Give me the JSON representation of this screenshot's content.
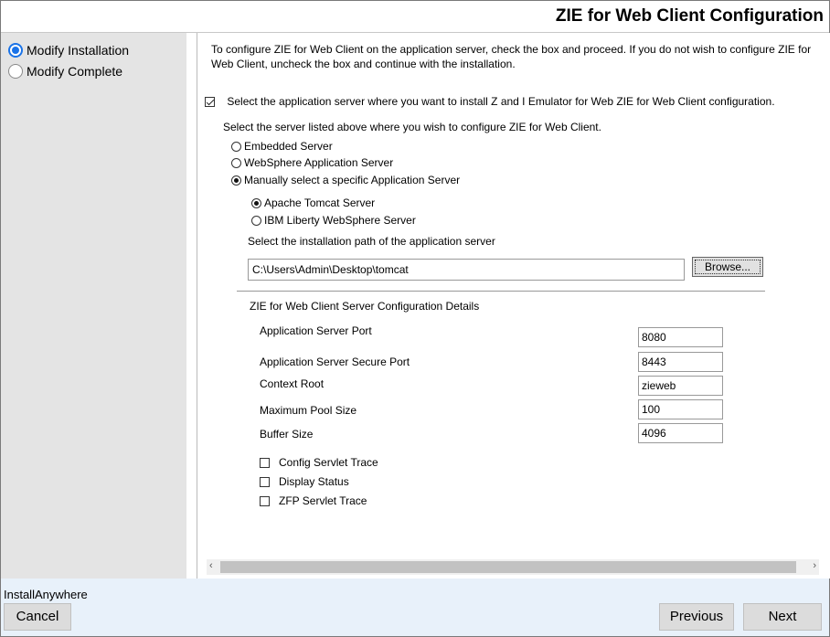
{
  "window": {
    "title": "ZIE for Web Client Configuration"
  },
  "steps": [
    {
      "label": "Modify Installation",
      "active": true
    },
    {
      "label": "Modify Complete",
      "active": false
    }
  ],
  "intro": "To configure ZIE for Web Client on the application server, check the box and proceed. If you do not wish to configure ZIE for Web Client, uncheck the box and continue with the installation.",
  "select_server_checkbox": {
    "label": "Select the application server where you want to install Z and I Emulator for Web ZIE for Web Client configuration.",
    "checked": true
  },
  "server_prompt": "Select the server listed above where you wish to configure ZIE for Web Client.",
  "server_options": [
    {
      "label": "Embedded Server",
      "selected": false
    },
    {
      "label": "WebSphere Application Server",
      "selected": false
    },
    {
      "label": "Manually select a specific Application Server",
      "selected": true
    }
  ],
  "manual_options": [
    {
      "label": "Apache Tomcat Server",
      "selected": true
    },
    {
      "label": "IBM Liberty WebSphere Server",
      "selected": false
    }
  ],
  "path_prompt": "Select the installation path of the application server",
  "path_value": "C:\\Users\\Admin\\Desktop\\tomcat",
  "browse_label": "Browse...",
  "details_heading": "ZIE for Web Client Server Configuration Details",
  "fields": [
    {
      "label": "Application Server Port",
      "value": "8080"
    },
    {
      "label": "Application Server Secure Port",
      "value": "8443"
    },
    {
      "label": "Context Root",
      "value": "zieweb"
    },
    {
      "label": "Maximum Pool Size",
      "value": "100"
    },
    {
      "label": "Buffer Size",
      "value": "4096"
    }
  ],
  "options": [
    {
      "label": "Config Servlet Trace",
      "checked": false
    },
    {
      "label": "Display Status",
      "checked": false
    },
    {
      "label": "ZFP Servlet Trace",
      "checked": false
    }
  ],
  "footer": {
    "brand": "InstallAnywhere",
    "cancel": "Cancel",
    "previous": "Previous",
    "next": "Next"
  }
}
